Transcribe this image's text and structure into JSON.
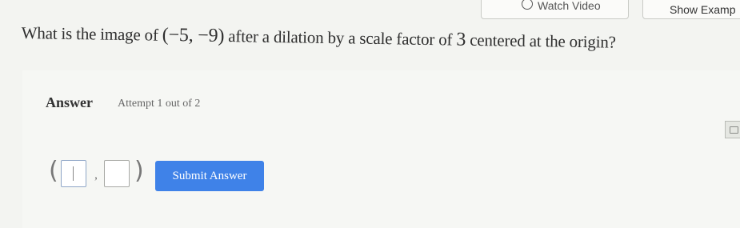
{
  "header": {
    "watch_video_label": "Watch Video",
    "show_example_label": "Show Examp"
  },
  "question": {
    "prefix": "What is the image of ",
    "point": "(−5, −9)",
    "middle": " after a dilation by a scale factor of ",
    "scale_factor": "3",
    "suffix": " centered at the origin?"
  },
  "answer": {
    "label": "Answer",
    "attempt": "Attempt 1 out of 2",
    "open_paren": "(",
    "comma": ",",
    "close_paren": ")",
    "x_value": "",
    "y_value": "",
    "submit_label": "Submit Answer"
  },
  "icons": {
    "play": "play-circle-icon",
    "side_tab": "calculator-icon"
  },
  "colors": {
    "submit": "#3f82e8",
    "background": "#f3f4f1"
  }
}
